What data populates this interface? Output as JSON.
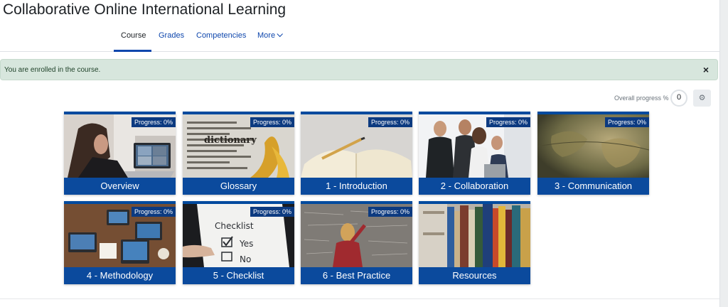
{
  "course": {
    "title": "Collaborative Online International Learning"
  },
  "nav": {
    "tabs": [
      {
        "label": "Course"
      },
      {
        "label": "Grades"
      },
      {
        "label": "Competencies"
      },
      {
        "label": "More"
      }
    ],
    "active_tab": "Course"
  },
  "alert": {
    "message": "You are enrolled in the course.",
    "close_symbol": "×"
  },
  "overall_progress": {
    "label": "Overall progress %",
    "value": "0",
    "settings_icon": "gear-icon"
  },
  "tiles": [
    {
      "title": "Overview",
      "progress": "Progress: 0%"
    },
    {
      "title": "Glossary",
      "progress": "Progress: 0%"
    },
    {
      "title": "1 - Introduction",
      "progress": "Progress: 0%"
    },
    {
      "title": "2 - Collaboration",
      "progress": "Progress: 0%"
    },
    {
      "title": "3 - Communication",
      "progress": "Progress: 0%"
    },
    {
      "title": "4 - Methodology",
      "progress": "Progress: 0%"
    },
    {
      "title": "5 - Checklist",
      "progress": "Progress: 0%"
    },
    {
      "title": "6 - Best Practice",
      "progress": "Progress: 0%"
    },
    {
      "title": "Resources"
    }
  ],
  "colors": {
    "accent": "#0f47ad",
    "tile_bar": "#0b4a9d",
    "alert_bg": "#d7e6dd"
  }
}
